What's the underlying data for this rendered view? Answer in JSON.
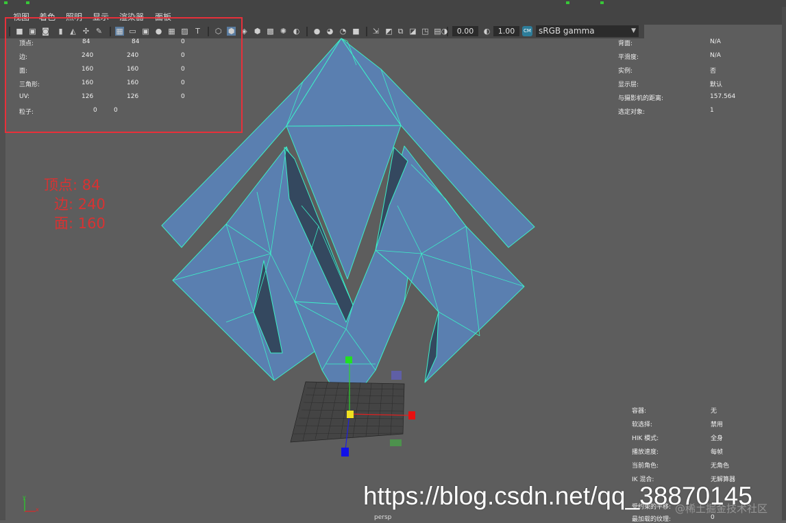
{
  "menu": [
    "视图",
    "着色",
    "照明",
    "显示",
    "渲染器",
    "面板"
  ],
  "toolbar": {
    "exposure": "0.00",
    "gamma": "1.00",
    "color_space": "sRGB gamma",
    "color_badge": "CM"
  },
  "stats_left": {
    "rows": [
      {
        "label": "顶点:",
        "a": "84",
        "b": "84",
        "c": "0"
      },
      {
        "label": "边:",
        "a": "240",
        "b": "240",
        "c": "0"
      },
      {
        "label": "面:",
        "a": "160",
        "b": "160",
        "c": "0"
      },
      {
        "label": "三角形:",
        "a": "160",
        "b": "160",
        "c": "0"
      },
      {
        "label": "UV:",
        "a": "126",
        "b": "126",
        "c": "0"
      },
      {
        "label": "粒子:",
        "a": "0",
        "b": "0",
        "c": ""
      }
    ]
  },
  "stats_right": {
    "rows": [
      {
        "label": "背面:",
        "value": "N/A"
      },
      {
        "label": "平滑度:",
        "value": "N/A"
      },
      {
        "label": "实例:",
        "value": "否"
      },
      {
        "label": "显示层:",
        "value": "默认"
      },
      {
        "label": "与摄影机的距离:",
        "value": "157.564"
      },
      {
        "label": "选定对象:",
        "value": "1"
      }
    ]
  },
  "stats_bottom_right": {
    "rows": [
      {
        "label": "容器:",
        "value": "无"
      },
      {
        "label": "软选择:",
        "value": "禁用"
      },
      {
        "label": "HIK 模式:",
        "value": "全身"
      },
      {
        "label": "播放速度:",
        "value": "每帧"
      },
      {
        "label": "当前角色:",
        "value": "无角色"
      },
      {
        "label": "IK 混合:",
        "value": "无解算器"
      },
      {
        "label": "受约束的平移:",
        "value": ""
      },
      {
        "label": "最加载的纹理:",
        "value": "0"
      }
    ]
  },
  "annotation": {
    "line1": "顶点: 84",
    "line2": "边: 240",
    "line3": "面: 160"
  },
  "camera": "persp",
  "watermark": "https://blog.csdn.net/qq_38870145",
  "watermark_small": "@稀土掘金技术社区",
  "colors": {
    "mesh_fill": "#5a7fb0",
    "mesh_wire": "#3cf0c8",
    "annotation_red": "#d83232",
    "viewport_bg": "#5d5d5d"
  }
}
